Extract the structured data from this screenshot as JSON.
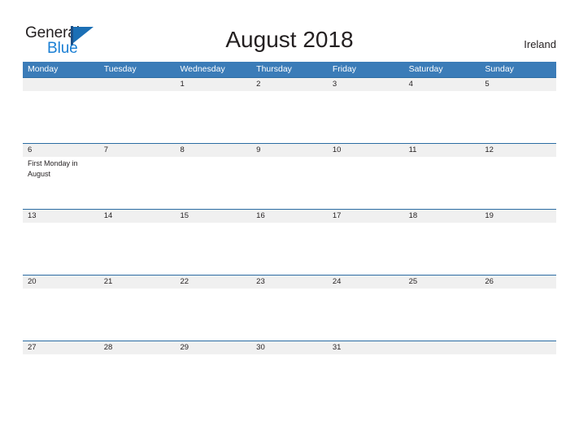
{
  "brand": {
    "word_one": "General",
    "word_two": "Blue",
    "mark": "triangle-flag-icon",
    "accent_dark": "#1b4f87",
    "accent_mid": "#1b6fb5",
    "accent_light": "#1a7fd4"
  },
  "header": {
    "title": "August 2018",
    "country": "Ireland"
  },
  "colors": {
    "header_blue": "#3b7cb8",
    "rule_blue": "#2b6ca3",
    "day_band_gray": "#f0f0f0",
    "text": "#231f20"
  },
  "calendar": {
    "month": "August",
    "year": "2018",
    "first_day_of_week": "Monday",
    "weekdays": [
      "Monday",
      "Tuesday",
      "Wednesday",
      "Thursday",
      "Friday",
      "Saturday",
      "Sunday"
    ],
    "weeks": [
      {
        "days": [
          {
            "num": "",
            "event": ""
          },
          {
            "num": "",
            "event": ""
          },
          {
            "num": "1",
            "event": ""
          },
          {
            "num": "2",
            "event": ""
          },
          {
            "num": "3",
            "event": ""
          },
          {
            "num": "4",
            "event": ""
          },
          {
            "num": "5",
            "event": ""
          }
        ]
      },
      {
        "days": [
          {
            "num": "6",
            "event": "First Monday in August"
          },
          {
            "num": "7",
            "event": ""
          },
          {
            "num": "8",
            "event": ""
          },
          {
            "num": "9",
            "event": ""
          },
          {
            "num": "10",
            "event": ""
          },
          {
            "num": "11",
            "event": ""
          },
          {
            "num": "12",
            "event": ""
          }
        ]
      },
      {
        "days": [
          {
            "num": "13",
            "event": ""
          },
          {
            "num": "14",
            "event": ""
          },
          {
            "num": "15",
            "event": ""
          },
          {
            "num": "16",
            "event": ""
          },
          {
            "num": "17",
            "event": ""
          },
          {
            "num": "18",
            "event": ""
          },
          {
            "num": "19",
            "event": ""
          }
        ]
      },
      {
        "days": [
          {
            "num": "20",
            "event": ""
          },
          {
            "num": "21",
            "event": ""
          },
          {
            "num": "22",
            "event": ""
          },
          {
            "num": "23",
            "event": ""
          },
          {
            "num": "24",
            "event": ""
          },
          {
            "num": "25",
            "event": ""
          },
          {
            "num": "26",
            "event": ""
          }
        ]
      },
      {
        "days": [
          {
            "num": "27",
            "event": ""
          },
          {
            "num": "28",
            "event": ""
          },
          {
            "num": "29",
            "event": ""
          },
          {
            "num": "30",
            "event": ""
          },
          {
            "num": "31",
            "event": ""
          },
          {
            "num": "",
            "event": ""
          },
          {
            "num": "",
            "event": ""
          }
        ]
      }
    ]
  }
}
